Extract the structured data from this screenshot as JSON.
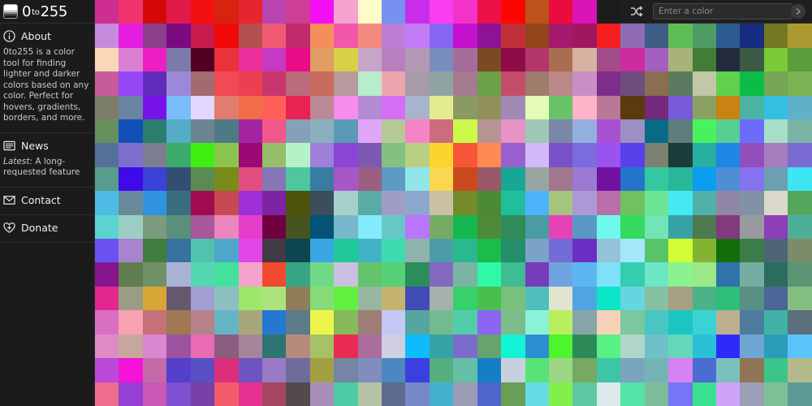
{
  "app": {
    "title_main": "0",
    "title_to": "to",
    "title_end": "255"
  },
  "sidebar": {
    "about": {
      "label": "About",
      "text": "0to255 is a color tool for finding lighter and darker colors based on any color. Perfect for hovers, gradients, borders, and more."
    },
    "news": {
      "label": "News",
      "latest_prefix": "Latest:",
      "latest_text": " A long-requested feature"
    },
    "contact": {
      "label": "Contact"
    },
    "donate": {
      "label": "Donate"
    }
  },
  "topbar": {
    "input_placeholder": "Enter a color",
    "shuffle_icon": "shuffle-icon",
    "go_icon": "arrow-right-icon"
  },
  "grid": {
    "columns": 30,
    "rows": 17,
    "colors": [
      "#ce2e8f",
      "#f1336c",
      "#d40808",
      "#e21a4a",
      "#f21010",
      "#d62410",
      "#e6252e",
      "#b845b0",
      "#ce3d96",
      "#f50ef3",
      "#f5a3cf",
      "#fbfcc9",
      "#7891f0",
      "#c82ee9",
      "#f83ef0",
      "#f232c8",
      "#ec0f48",
      "#fb0601",
      "#bc531c",
      "#ea0c3e",
      "#da14b5",
      "#1c1c1c",
      "#2a2a2a",
      "#2a2a2a",
      "#2a2a2a",
      "#2a2a2a",
      "#2a2a2a",
      "#2a2a2a",
      "#2a2a2a",
      "#2a2a2a",
      "#c78bde",
      "#e51ee1",
      "#8b3f8a",
      "#7b097f",
      "#c71c4d",
      "#f10909",
      "#b44f4d",
      "#f05a71",
      "#c02a6b",
      "#f48e5b",
      "#f257a9",
      "#f48a7d",
      "#bd7fd6",
      "#c27bf5",
      "#8566f2",
      "#c411cd",
      "#8d1297",
      "#c03039",
      "#93451c",
      "#a6196f",
      "#a01760",
      "#f41e1e",
      "#8e6bb5",
      "#3d5d85",
      "#5fbd56",
      "#4e9b63",
      "#2d5b90",
      "#162c80",
      "#727921",
      "#ab9a30",
      "#fbd7b7",
      "#d97ed3",
      "#ee1ec2",
      "#7b7aa9",
      "#520022",
      "#e93239",
      "#ed2f9b",
      "#c53ac2",
      "#ea0c86",
      "#df9d62",
      "#d7d14a",
      "#c8a6c9",
      "#b87fbe",
      "#b29ab7",
      "#798dbd",
      "#a46d9b",
      "#7a4a22",
      "#8e0c47",
      "#b3366c",
      "#a96e4f",
      "#d7b1a2",
      "#a44b89",
      "#cb2da0",
      "#a35fc0",
      "#a7b377",
      "#437c37",
      "#222b3d",
      "#3b5945",
      "#7bcb36",
      "#5a9d3a",
      "#c75c9b",
      "#9645f7",
      "#632cbb",
      "#9d87d8",
      "#a36b70",
      "#f24a55",
      "#ec4052",
      "#c9356d",
      "#ba6b7c",
      "#c86a5d",
      "#b79a9d",
      "#b8edcb",
      "#eea6ac",
      "#a79ba9",
      "#8fa4a1",
      "#a57a8e",
      "#6ca04a",
      "#c54d6b",
      "#9e7d6d",
      "#bb8787",
      "#c98ec5",
      "#7e2d8a",
      "#6e4c7c",
      "#8b6e50",
      "#5c7a60",
      "#c2c7a5",
      "#5fd14b",
      "#0bbd47",
      "#76a756",
      "#7cb453",
      "#7c7e6b",
      "#6b84a1",
      "#7712ea",
      "#78bcfb",
      "#e2d6fc",
      "#e17c6e",
      "#f06d48",
      "#ff6059",
      "#ea2253",
      "#bb8896",
      "#f78cec",
      "#b48bd2",
      "#d56ff5",
      "#a8b4cd",
      "#e3ec91",
      "#8b9a63",
      "#8f9158",
      "#a18bb5",
      "#e4fab7",
      "#68c267",
      "#fdb3c7",
      "#b9779a",
      "#5b3a0d",
      "#75297a",
      "#775ad8",
      "#8aa163",
      "#c88312",
      "#4cb4a3",
      "#34c0e3",
      "#61b0c9",
      "#668f5e",
      "#1250b7",
      "#2b7d6d",
      "#54acc6",
      "#6c8393",
      "#4c7a85",
      "#a2259f",
      "#f0578b",
      "#86a0b8",
      "#8caec1",
      "#5a9ab4",
      "#e0a6f7",
      "#b6c994",
      "#f485c5",
      "#cc6c7c",
      "#ccfa4b",
      "#b79394",
      "#e693c5",
      "#9dc9b5",
      "#7b87a7",
      "#93b0dd",
      "#a852d3",
      "#9c8fc4",
      "#076b88",
      "#5e7e7d",
      "#48f25e",
      "#56cf93",
      "#6a6dfa",
      "#a7dec8",
      "#7ab4a4",
      "#537098",
      "#7d6fce",
      "#7c7d8e",
      "#3cab6b",
      "#40ee0f",
      "#8ac64f",
      "#9c0874",
      "#97bf6b",
      "#b5f3c6",
      "#a07fdb",
      "#8b45d7",
      "#7a5bb1",
      "#86c080",
      "#b8cf84",
      "#fbd430",
      "#f6573a",
      "#fd8a53",
      "#9a5fcf",
      "#d3b9f8",
      "#7b51c9",
      "#7a6bdf",
      "#9a53ee",
      "#5941ea",
      "#7d8171",
      "#193d3a",
      "#27b0a0",
      "#1e87e6",
      "#9250bc",
      "#a67dbe",
      "#7b6ad2",
      "#579c8c",
      "#3e0be8",
      "#3a42d7",
      "#324f71",
      "#5a8c52",
      "#7b8a18",
      "#e14f82",
      "#8576b6",
      "#4ec69f",
      "#3a7ca0",
      "#a857c6",
      "#9b6081",
      "#5d9bc5",
      "#90e5e8",
      "#fbd751",
      "#ca4a1f",
      "#995869",
      "#18a795",
      "#9aa5a2",
      "#a1768e",
      "#9c79d2",
      "#70129f",
      "#2474ca",
      "#33c99e",
      "#28b899",
      "#0b9df2",
      "#4d8fd4",
      "#8772f0",
      "#6b9fb1",
      "#3ee6f3",
      "#4ebbe5",
      "#6a8a9b",
      "#2f93e0",
      "#396e80",
      "#a00a50",
      "#c54a51",
      "#9f30d6",
      "#7e24a2",
      "#4c5509",
      "#3b4e5b",
      "#a6d0ca",
      "#5aaaa6",
      "#a09dc4",
      "#8ba7cc",
      "#cac1a1",
      "#758a2a",
      "#4d8a36",
      "#21be9b",
      "#4db4fb",
      "#a5c47e",
      "#ac98d4",
      "#b86fa7",
      "#6fc25f",
      "#6ce593",
      "#44e9f2",
      "#50b0aa",
      "#9087a6",
      "#8391a6",
      "#dad8c8",
      "#54a65e",
      "#5bd3d0",
      "#9ccdc2",
      "#7c9a7d",
      "#5a8f7c",
      "#a7589d",
      "#ea86bc",
      "#e43ec9",
      "#6f0142",
      "#47541f",
      "#035377",
      "#76b9ca",
      "#82ecfc",
      "#68c7c6",
      "#b876fc",
      "#74ac63",
      "#17b750",
      "#4f8a38",
      "#2f8b57",
      "#4b9ba4",
      "#e543b5",
      "#5998c5",
      "#6ff9ec",
      "#34d95d",
      "#72e4b8",
      "#37a3a4",
      "#4d7a50",
      "#803a7d",
      "#989a9e",
      "#8b3eb7",
      "#4eaf99",
      "#6a52f2",
      "#a884cf",
      "#3f7d3f",
      "#37729f",
      "#51c2b0",
      "#4fa6c8",
      "#e046e8",
      "#423a45",
      "#0c464f",
      "#3aa6e3",
      "#22c998",
      "#42b3c6",
      "#3fdbb0",
      "#8fb4ad",
      "#4b9ba9",
      "#2ab98f",
      "#1abc4a",
      "#238e6c",
      "#7da2c9",
      "#736cd6",
      "#6a2ec3",
      "#95c2db",
      "#a3e8fa",
      "#58c46a",
      "#d3fe36",
      "#82b432",
      "#126e0b",
      "#3c7c4b",
      "#4d6577",
      "#7c8c6b",
      "#86168d",
      "#5e7e4e",
      "#6f9168",
      "#a9b4d4",
      "#54d6b1",
      "#44e19d",
      "#f4a4cc",
      "#f1492f",
      "#37a583",
      "#6eda87",
      "#c9c0e1",
      "#64c36b",
      "#56d175",
      "#2b8c5c",
      "#8469c0",
      "#7ab5a3",
      "#2ff9a9",
      "#3dbd91",
      "#783cbb",
      "#70a4e1",
      "#5eb6f0",
      "#7ee1f9",
      "#34cdae",
      "#6be7c7",
      "#8af28f",
      "#9be887",
      "#2f73aa",
      "#74ada0",
      "#2b6c5e",
      "#5c9574",
      "#e3278f",
      "#9a9c84",
      "#d6a736",
      "#66596e",
      "#a19ed2",
      "#8cbfbf",
      "#9de86a",
      "#ade17c",
      "#8f7d58",
      "#86da78",
      "#62f141",
      "#97b69f",
      "#c3b36f",
      "#434bb6",
      "#a5b2ab",
      "#38cf6c",
      "#4bbf4b",
      "#78c07e",
      "#4ebfbd",
      "#e1e4cf",
      "#4fa5e4",
      "#0be6c7",
      "#64d6e1",
      "#85c0a0",
      "#a69f86",
      "#4bb389",
      "#2cbe7a",
      "#5a8f84",
      "#496696",
      "#84bd80",
      "#d86fc0",
      "#f9a0b2",
      "#c6717a",
      "#a07854",
      "#b5828b",
      "#66b3c4",
      "#a7a879",
      "#2478d1",
      "#5c7c8a",
      "#eef54a",
      "#85b95a",
      "#9e7f76",
      "#c3c8f4",
      "#56a6a0",
      "#72bb90",
      "#53cda8",
      "#8c66f2",
      "#7bbd8a",
      "#8cf2d7",
      "#b8ef5f",
      "#88a4a7",
      "#f5d1b8",
      "#7ac7a0",
      "#4ac5c4",
      "#1bc6c2",
      "#39d3d3",
      "#bdaf90",
      "#4d7c9e",
      "#41b1a8",
      "#5b6f7d",
      "#de8bc8",
      "#c6a79c",
      "#dc87d1",
      "#9d52a1",
      "#e86bb3",
      "#8c5d7f",
      "#a6859c",
      "#2d7473",
      "#b78a7e",
      "#a7c167",
      "#ea2c52",
      "#ab6d9e",
      "#cfcfe1",
      "#0fbbfb",
      "#37a2a7",
      "#7c6ccd",
      "#67a36d",
      "#13f3d6",
      "#2b8fd1",
      "#4ef42c",
      "#2b8a58",
      "#57f283",
      "#b1d6c9",
      "#6fc0c8",
      "#65d7bb",
      "#2bc0d5",
      "#2c2bfa",
      "#6fa6d2",
      "#2a9db8",
      "#5ac4f9",
      "#bb48d6",
      "#f413d8",
      "#c46aa8",
      "#533fcc",
      "#5950c4",
      "#db2f7b",
      "#6d54c0",
      "#9b7bc3",
      "#6e6c9b",
      "#a39f45",
      "#7486a4",
      "#818dbc",
      "#4d87c0",
      "#3b3fdf",
      "#54b07f",
      "#64c1a8",
      "#157fc5",
      "#c7d0df",
      "#57e37a",
      "#9cd786",
      "#77a963",
      "#3dc6a6",
      "#79a6bc",
      "#74b4b7",
      "#d583f2",
      "#4c6bd3",
      "#7bc0bc",
      "#907656",
      "#3bc58b",
      "#b2ba8b",
      "#f06c8c",
      "#9440d2",
      "#c857b6",
      "#7d4fd1",
      "#7a3fa8",
      "#f45b6a",
      "#e4308f",
      "#a2475f",
      "#544a4e",
      "#ab8dbb",
      "#4ecba4",
      "#b4c3a3",
      "#5d6a8d",
      "#7688c8",
      "#44b1cf",
      "#9c9bb4",
      "#4d66cb",
      "#6a9e57",
      "#66dbe4",
      "#82f04c",
      "#5fc8a2",
      "#dce8e9",
      "#51e3a8",
      "#7fbc9a",
      "#7575f6",
      "#3bdf92",
      "#d0a2fa",
      "#9a9fb5",
      "#7dc198",
      "#5d9a95"
    ]
  }
}
